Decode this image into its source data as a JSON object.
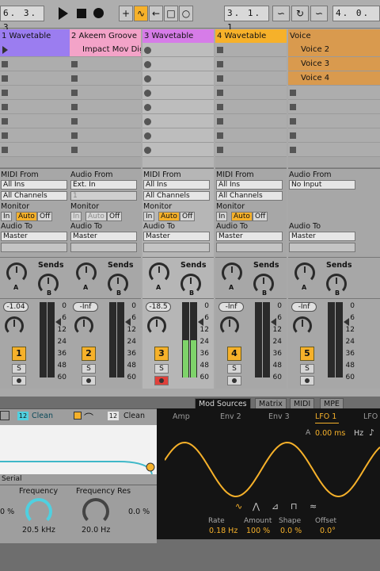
{
  "transport": {
    "position_left": "6. 3. 3",
    "position_center": "3. 1. 1",
    "position_right": "4. 0."
  },
  "tracks": [
    {
      "name": "1 Wavetable",
      "color": "#9b7df0",
      "clips": [],
      "io_from_label": "MIDI From",
      "io_from_value": "All Ins",
      "io_channel_value": "All Channels",
      "monitor_label": "Monitor",
      "monitor": {
        "in": "In",
        "auto": "Auto",
        "off": "Off",
        "active": "auto"
      },
      "audio_to_label": "Audio To",
      "audio_to_value": "Master",
      "sends_label": "Sends",
      "volume": "-1.04",
      "number": "1",
      "solo": "S",
      "armed": false,
      "meter_level": 0
    },
    {
      "name": "2 Akeem Groove",
      "color": "#f3a3c8",
      "clips": [
        {
          "name": "Impact Mov Dig",
          "color": "#f3a3c8"
        }
      ],
      "io_from_label": "Audio From",
      "io_from_value": "Ext. In",
      "io_channel_value": "1",
      "monitor_label": "Monitor",
      "monitor": {
        "in": "In",
        "auto": "Auto",
        "off": "Off",
        "active": "none"
      },
      "audio_to_label": "Audio To",
      "audio_to_value": "Master",
      "sends_label": "Sends",
      "volume": "-Inf",
      "number": "2",
      "solo": "S",
      "armed": false,
      "meter_level": 0
    },
    {
      "name": "3 Wavetable",
      "color": "#d67ce8",
      "clips": [],
      "io_from_label": "MIDI From",
      "io_from_value": "All Ins",
      "io_channel_value": "All Channels",
      "monitor_label": "Monitor",
      "monitor": {
        "in": "In",
        "auto": "Auto",
        "off": "Off",
        "active": "auto"
      },
      "audio_to_label": "Audio To",
      "audio_to_value": "Master",
      "sends_label": "Sends",
      "volume": "-18.5",
      "number": "3",
      "solo": "S",
      "armed": true,
      "meter_level": 0.5
    },
    {
      "name": "4 Wavetable",
      "color": "#f6b12a",
      "clips": [],
      "io_from_label": "MIDI From",
      "io_from_value": "All Ins",
      "io_channel_value": "All Channels",
      "monitor_label": "Monitor",
      "monitor": {
        "in": "In",
        "auto": "Auto",
        "off": "Off",
        "active": "auto"
      },
      "audio_to_label": "Audio To",
      "audio_to_value": "Master",
      "sends_label": "Sends",
      "volume": "-Inf",
      "number": "4",
      "solo": "S",
      "armed": false,
      "meter_level": 0
    },
    {
      "name": "Voice",
      "color": "#d99a4e",
      "clips": [
        {
          "name": "Voice 2",
          "color": "#d99a4e"
        },
        {
          "name": "Voice 3",
          "color": "#d99a4e"
        },
        {
          "name": "Voice 4",
          "color": "#d99a4e"
        }
      ],
      "io_from_label": "Audio From",
      "io_from_value": "No Input",
      "io_channel_value": "",
      "monitor_label": "",
      "monitor": null,
      "audio_to_label": "Audio To",
      "audio_to_value": "Master",
      "sends_label": "Sends",
      "volume": "-Inf",
      "number": "5",
      "solo": "S",
      "armed": false,
      "meter_level": 0
    }
  ],
  "meter_scale": [
    "0",
    "6",
    "12",
    "24",
    "36",
    "48",
    "60"
  ],
  "send_knobs": [
    "A",
    "B"
  ],
  "device": {
    "tabs": [
      "Mod Sources",
      "Matrix",
      "MIDI",
      "MPE"
    ],
    "active_tab": "Mod Sources",
    "filter": {
      "badge1": "12",
      "type1": "Clean",
      "badge2": "12",
      "type2": "Clean",
      "routing": "Serial",
      "left_percent": "0 %",
      "freq_label": "Frequency",
      "freq_value": "20.5 kHz",
      "freqres_label": "Frequency Res",
      "freqres_value": "20.0 Hz",
      "freqres_percent": "0.0 %"
    },
    "mod": {
      "subtabs": [
        "Amp",
        "Env 2",
        "Env 3",
        "LFO 1",
        "LFO"
      ],
      "active_subtab": "LFO 1",
      "attack_label": "A",
      "attack_value": "0.00 ms",
      "hz_label": "Hz",
      "params": [
        {
          "label": "Rate",
          "value": "0.18 Hz"
        },
        {
          "label": "Amount",
          "value": "100 %"
        },
        {
          "label": "Shape",
          "value": "0.0 %"
        },
        {
          "label": "Offset",
          "value": "0.0°"
        }
      ]
    }
  },
  "colors": {
    "accent": "#f6b12a",
    "wave": "#f6b12a",
    "filter_curve": "#4fd0e0"
  }
}
